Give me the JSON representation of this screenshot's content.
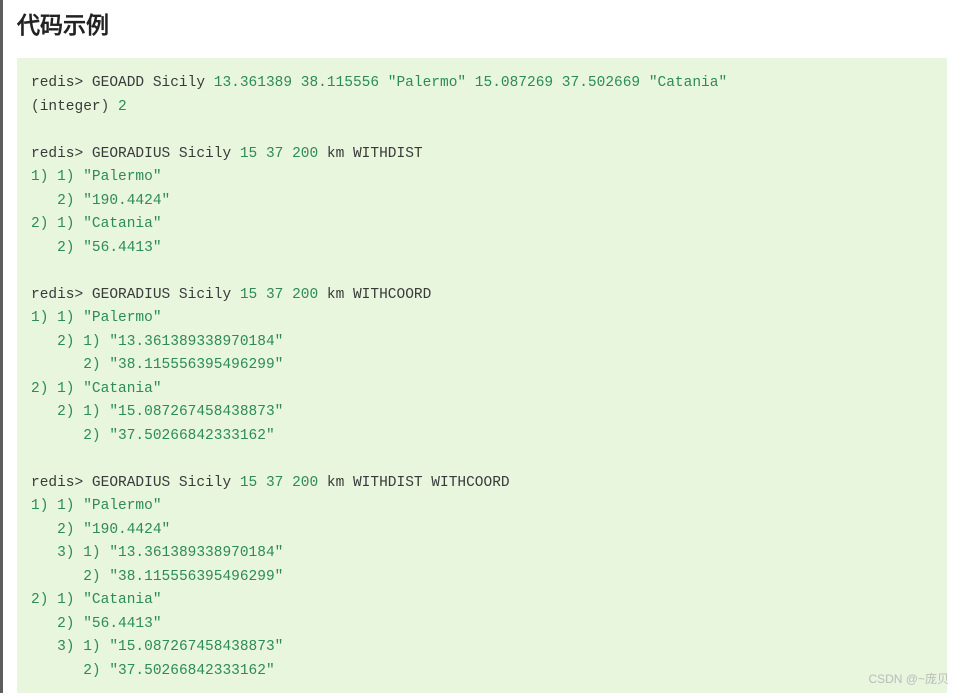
{
  "title": "代码示例",
  "watermark": "CSDN @~庞贝",
  "lines": [
    [
      {
        "t": "redis> ",
        "c": "kw"
      },
      {
        "t": "GEOADD Sicily ",
        "c": "kw"
      },
      {
        "t": "13.361389 38.115556 ",
        "c": "num"
      },
      {
        "t": "\"Palermo\" ",
        "c": "str"
      },
      {
        "t": "15.087269 37.502669 ",
        "c": "num"
      },
      {
        "t": "\"Catania\"",
        "c": "str"
      }
    ],
    [
      {
        "t": "(",
        "c": "paren"
      },
      {
        "t": "integer",
        "c": "kw"
      },
      {
        "t": ") ",
        "c": "paren"
      },
      {
        "t": "2",
        "c": "num"
      }
    ],
    [
      {
        "t": "",
        "c": ""
      }
    ],
    [
      {
        "t": "redis> ",
        "c": "kw"
      },
      {
        "t": "GEORADIUS Sicily ",
        "c": "kw"
      },
      {
        "t": "15 37 200 ",
        "c": "num"
      },
      {
        "t": "km WITHDIST",
        "c": "kw"
      }
    ],
    [
      {
        "t": "1) 1) ",
        "c": "idx"
      },
      {
        "t": "\"Palermo\"",
        "c": "str"
      }
    ],
    [
      {
        "t": "   2) ",
        "c": "idx"
      },
      {
        "t": "\"190.4424\"",
        "c": "str"
      }
    ],
    [
      {
        "t": "2) 1) ",
        "c": "idx"
      },
      {
        "t": "\"Catania\"",
        "c": "str"
      }
    ],
    [
      {
        "t": "   2) ",
        "c": "idx"
      },
      {
        "t": "\"56.4413\"",
        "c": "str"
      }
    ],
    [
      {
        "t": "",
        "c": ""
      }
    ],
    [
      {
        "t": "redis> ",
        "c": "kw"
      },
      {
        "t": "GEORADIUS Sicily ",
        "c": "kw"
      },
      {
        "t": "15 37 200 ",
        "c": "num"
      },
      {
        "t": "km WITHCOORD",
        "c": "kw"
      }
    ],
    [
      {
        "t": "1) 1) ",
        "c": "idx"
      },
      {
        "t": "\"Palermo\"",
        "c": "str"
      }
    ],
    [
      {
        "t": "   2) 1) ",
        "c": "idx"
      },
      {
        "t": "\"13.361389338970184\"",
        "c": "str"
      }
    ],
    [
      {
        "t": "      2) ",
        "c": "idx"
      },
      {
        "t": "\"38.115556395496299\"",
        "c": "str"
      }
    ],
    [
      {
        "t": "2) 1) ",
        "c": "idx"
      },
      {
        "t": "\"Catania\"",
        "c": "str"
      }
    ],
    [
      {
        "t": "   2) 1) ",
        "c": "idx"
      },
      {
        "t": "\"15.087267458438873\"",
        "c": "str"
      }
    ],
    [
      {
        "t": "      2) ",
        "c": "idx"
      },
      {
        "t": "\"37.50266842333162\"",
        "c": "str"
      }
    ],
    [
      {
        "t": "",
        "c": ""
      }
    ],
    [
      {
        "t": "redis> ",
        "c": "kw"
      },
      {
        "t": "GEORADIUS Sicily ",
        "c": "kw"
      },
      {
        "t": "15 37 200 ",
        "c": "num"
      },
      {
        "t": "km WITHDIST WITHCOORD",
        "c": "kw"
      }
    ],
    [
      {
        "t": "1) 1) ",
        "c": "idx"
      },
      {
        "t": "\"Palermo\"",
        "c": "str"
      }
    ],
    [
      {
        "t": "   2) ",
        "c": "idx"
      },
      {
        "t": "\"190.4424\"",
        "c": "str"
      }
    ],
    [
      {
        "t": "   3) 1) ",
        "c": "idx"
      },
      {
        "t": "\"13.361389338970184\"",
        "c": "str"
      }
    ],
    [
      {
        "t": "      2) ",
        "c": "idx"
      },
      {
        "t": "\"38.115556395496299\"",
        "c": "str"
      }
    ],
    [
      {
        "t": "2) 1) ",
        "c": "idx"
      },
      {
        "t": "\"Catania\"",
        "c": "str"
      }
    ],
    [
      {
        "t": "   2) ",
        "c": "idx"
      },
      {
        "t": "\"56.4413\"",
        "c": "str"
      }
    ],
    [
      {
        "t": "   3) 1) ",
        "c": "idx"
      },
      {
        "t": "\"15.087267458438873\"",
        "c": "str"
      }
    ],
    [
      {
        "t": "      2) ",
        "c": "idx"
      },
      {
        "t": "\"37.50266842333162\"",
        "c": "str"
      }
    ]
  ]
}
